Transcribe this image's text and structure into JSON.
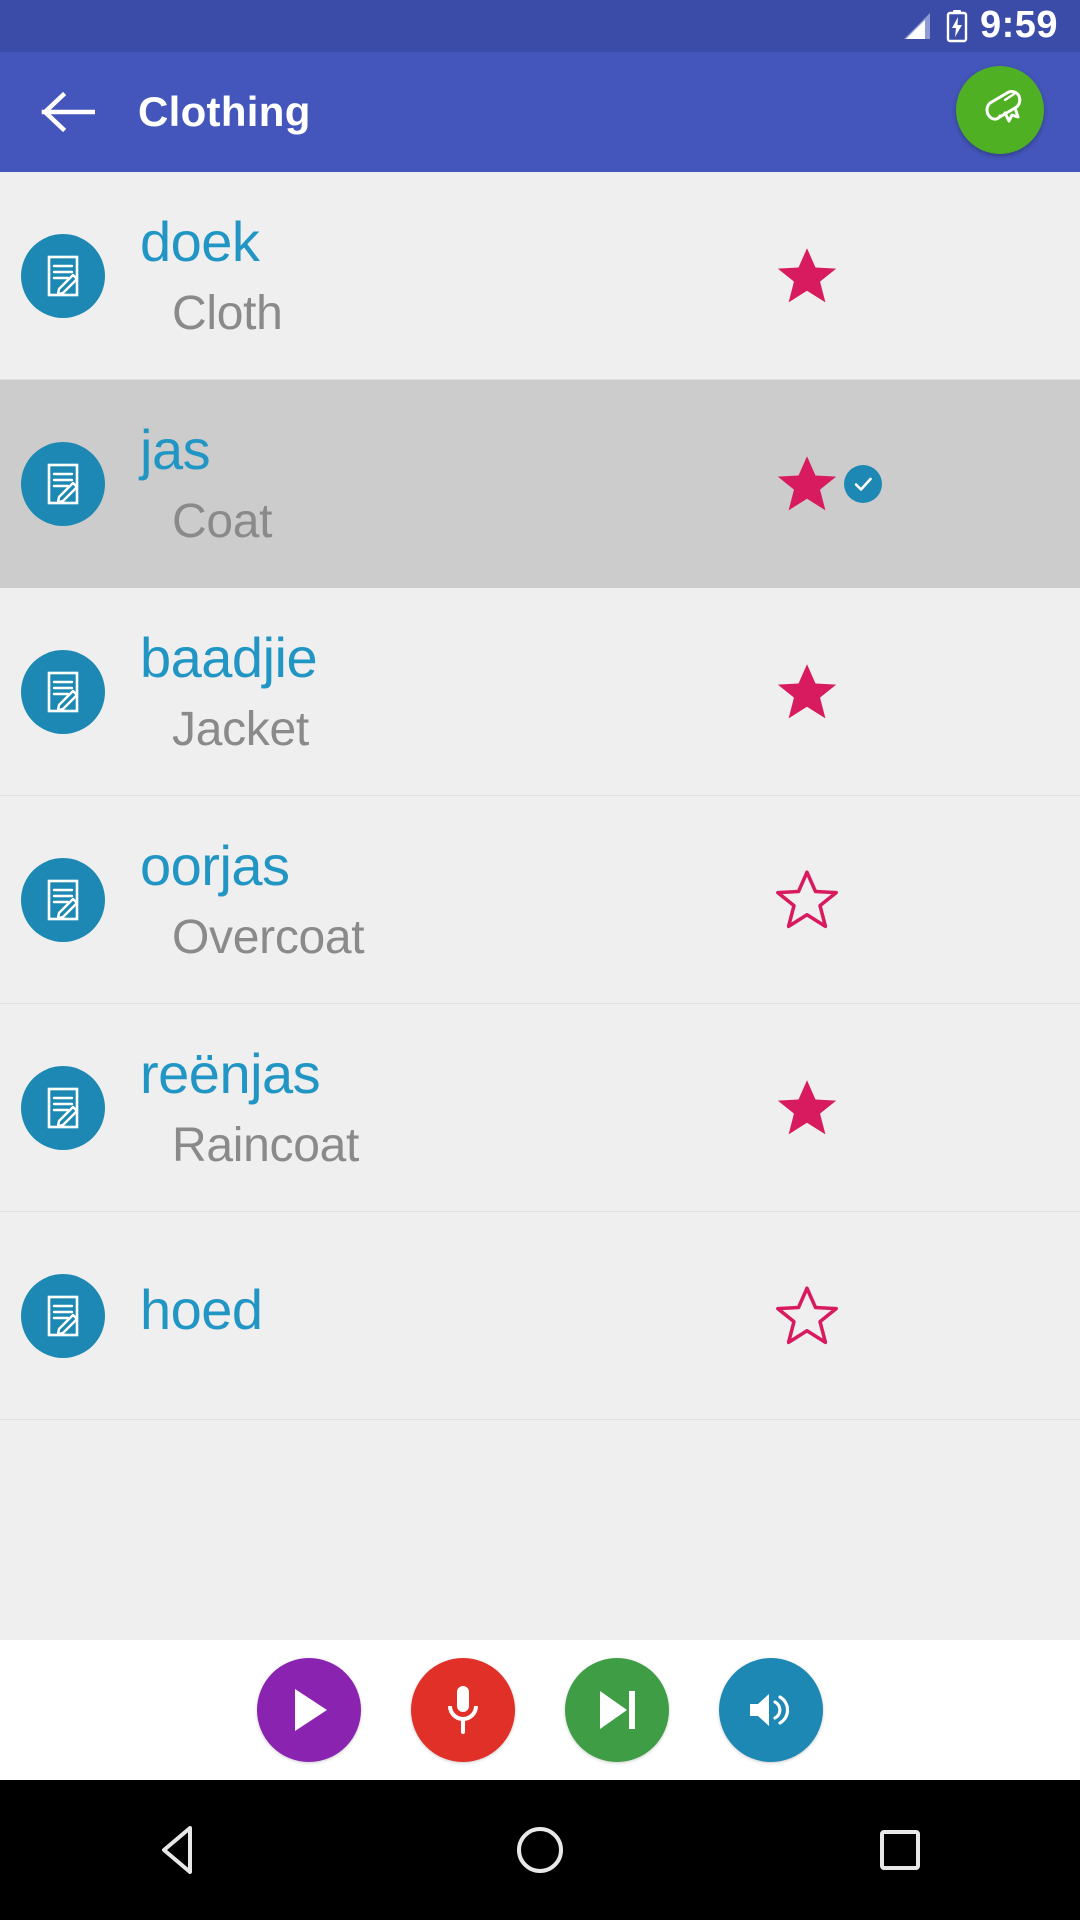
{
  "status_bar": {
    "time": "9:59",
    "signal_icon": "signal-bars-icon",
    "battery_icon": "battery-charging-icon",
    "background": "#3b4ba8"
  },
  "app_bar": {
    "back_icon": "back-arrow-icon",
    "title": "Clothing",
    "fab_icon": "diploma-scroll-icon",
    "fab_color": "#4eb022",
    "background": "#4456bb"
  },
  "list": {
    "avatar_icon": "note-edit-icon",
    "avatar_color": "#1d88b3",
    "word_color": "#2196c4",
    "translation_color": "#8a8a8a",
    "star_color": "#d81b5e",
    "selected_row_color": "#cccccc",
    "items": [
      {
        "word": "doek",
        "translation": "Cloth",
        "starred": true,
        "selected": false,
        "checked": false
      },
      {
        "word": "jas",
        "translation": "Coat",
        "starred": true,
        "selected": true,
        "checked": true
      },
      {
        "word": "baadjie",
        "translation": "Jacket",
        "starred": true,
        "selected": false,
        "checked": false
      },
      {
        "word": "oorjas",
        "translation": "Overcoat",
        "starred": false,
        "selected": false,
        "checked": false
      },
      {
        "word": "reënjas",
        "translation": "Raincoat",
        "starred": true,
        "selected": false,
        "checked": false
      },
      {
        "word": "hoed",
        "translation": "",
        "starred": false,
        "selected": false,
        "checked": false
      }
    ]
  },
  "controls": [
    {
      "name": "play-button",
      "icon": "play-icon",
      "color": "#8a24b0"
    },
    {
      "name": "record-button",
      "icon": "microphone-icon",
      "color": "#e03028"
    },
    {
      "name": "skip-next-button",
      "icon": "skip-next-icon",
      "color": "#3f9e45"
    },
    {
      "name": "speaker-button",
      "icon": "volume-up-icon",
      "color": "#1d88b3"
    }
  ],
  "nav_bar": [
    {
      "name": "nav-back",
      "icon": "triangle-back-icon"
    },
    {
      "name": "nav-home",
      "icon": "circle-home-icon"
    },
    {
      "name": "nav-recent",
      "icon": "square-recents-icon"
    }
  ]
}
